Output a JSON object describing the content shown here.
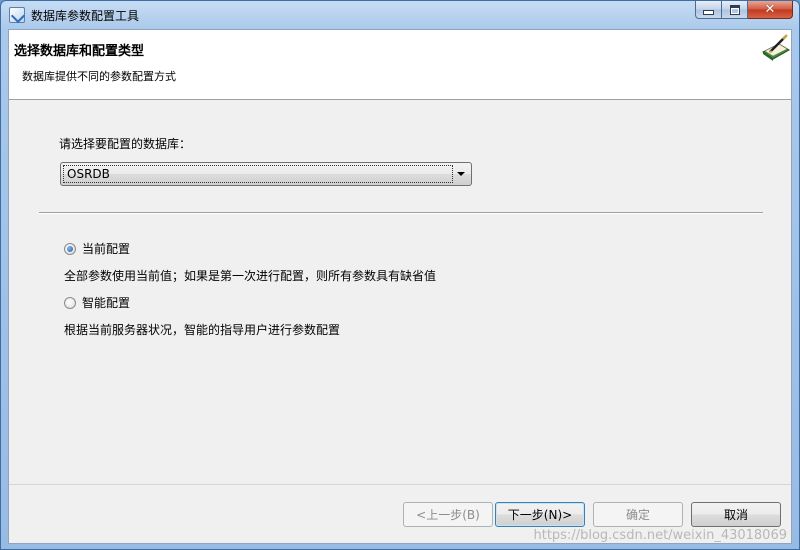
{
  "window": {
    "title": "数据库参数配置工具"
  },
  "header": {
    "title": "选择数据库和配置类型",
    "subtitle": "数据库提供不同的参数配置方式"
  },
  "form": {
    "select_label": "请选择要配置的数据库：",
    "database_value": "OSRDB",
    "options": [
      {
        "label": "当前配置",
        "checked": true,
        "description": "全部参数使用当前值；如果是第一次进行配置，则所有参数具有缺省值"
      },
      {
        "label": "智能配置",
        "checked": false,
        "description": "根据当前服务器状况，智能的指导用户进行参数配置"
      }
    ]
  },
  "buttons": {
    "back": "<上一步(B)",
    "next": "下一步(N)>",
    "ok": "确定",
    "cancel": "取消"
  },
  "watermark": "https://blog.csdn.net/weixin_43018069"
}
